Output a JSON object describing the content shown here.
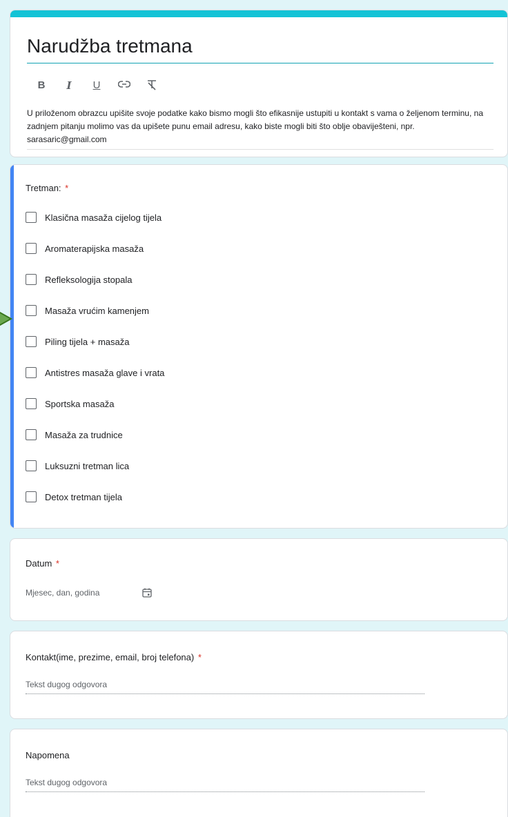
{
  "form": {
    "title": "Narudžba tretmana",
    "toolbar": {
      "bold": "B",
      "italic": "I",
      "underline": "U",
      "link_icon": "link-icon",
      "clear_format_icon": "clear-format-icon"
    },
    "description": "U priloženom obrazcu upišite svoje podatke kako bismo mogli  što efikasnije ustupiti u kontakt s vama o željenom terminu, na zadnjem pitanju molimo vas da upišete punu email adresu, kako biste mogli biti što oblje obaviješteni, npr. sarasaric@gmail.com"
  },
  "questions": {
    "treatment": {
      "label": "Tretman:",
      "required": "*",
      "options": [
        "Klasična masaža cijelog tijela",
        "Aromaterapijska masaža",
        "Refleksologija stopala",
        "Masaža vrućim kamenjem",
        "Piling tijela + masaža",
        "Antistres masaža glave i vrata",
        "Sportska masaža",
        "Masaža za trudnice",
        "Luksuzni tretman lica",
        "Detox tretman tijela"
      ]
    },
    "date": {
      "label": "Datum",
      "required": "*",
      "placeholder": "Mjesec, dan, godina",
      "icon": "calendar-icon"
    },
    "contact": {
      "label": "Kontakt(ime, prezime, email, broj telefona)",
      "required": "*",
      "placeholder": "Tekst dugog odgovora"
    },
    "note": {
      "label": "Napomena",
      "placeholder": "Tekst dugog odgovora"
    }
  },
  "colors": {
    "header_accent": "#12c3d6",
    "focus_bar": "#4285f4",
    "required": "#d93025",
    "arrow": "#6aa84f"
  }
}
